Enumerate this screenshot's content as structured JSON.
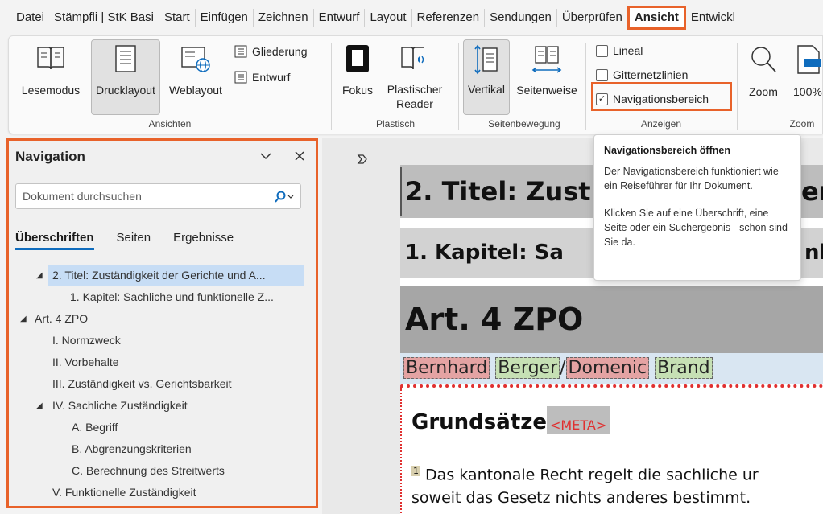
{
  "menu": {
    "items": [
      "Datei",
      "Stämpfli | StK Basi",
      "Start",
      "Einfügen",
      "Zeichnen",
      "Entwurf",
      "Layout",
      "Referenzen",
      "Sendungen",
      "Überprüfen",
      "Ansicht",
      "Entwickl"
    ],
    "active": "Ansicht"
  },
  "ribbon": {
    "ansichten": {
      "lesemodus": "Lesemodus",
      "drucklayout": "Drucklayout",
      "weblayout": "Weblayout",
      "gliederung": "Gliederung",
      "entwurf": "Entwurf",
      "group_label": "Ansichten"
    },
    "plastisch": {
      "fokus": "Fokus",
      "reader_line1": "Plastischer",
      "reader_line2": "Reader",
      "group_label": "Plastisch"
    },
    "seitenbewegung": {
      "vertikal": "Vertikal",
      "seitenweise": "Seitenweise",
      "group_label": "Seitenbewegung"
    },
    "anzeigen": {
      "lineal": "Lineal",
      "gitternetzlinien": "Gitternetzlinien",
      "navigationsbereich": "Navigationsbereich",
      "navigationsbereich_checked": true,
      "group_label": "Anzeigen"
    },
    "zoom": {
      "zoom": "Zoom",
      "percent": "100%",
      "group_label": "Zoom"
    }
  },
  "nav": {
    "title": "Navigation",
    "search_placeholder": "Dokument durchsuchen",
    "tabs": [
      "Überschriften",
      "Seiten",
      "Ergebnisse"
    ],
    "tree": [
      "2. Titel: Zuständigkeit der Gerichte und A...",
      "1. Kapitel: Sachliche und funktionelle Z...",
      "Art. 4 ZPO",
      "I. Normzweck",
      "II. Vorbehalte",
      "III. Zuständigkeit vs. Gerichtsbarkeit",
      "IV. Sachliche Zuständigkeit",
      "A. Begriff",
      "B. Abgrenzungskriterien",
      "C. Berechnung des Streitwerts",
      "V. Funktionelle Zuständigkeit"
    ]
  },
  "doc": {
    "title2": "2. Titel: Zust",
    "title2_tail": "er",
    "chapter": "1. Kapitel: Sa",
    "chapter_tail": "nl",
    "article": "Art. 4 ZPO",
    "authors": [
      "Bernhard",
      "Berger",
      "/",
      "Domenic",
      "Brand"
    ],
    "grundsaetze": "Grundsätze",
    "meta": "<META>",
    "para_num": "1",
    "para_line1": "Das kantonale Recht regelt die sachliche ur",
    "para_line2": "soweit das Gesetz nichts anderes bestimmt."
  },
  "tooltip": {
    "title": "Navigationsbereich öffnen",
    "p1": "Der Navigationsbereich funktioniert wie ein Reiseführer für Ihr Dokument.",
    "p2": "Klicken Sie auf eine Überschrift, eine Seite oder ein Suchergebnis - schon sind Sie da."
  }
}
